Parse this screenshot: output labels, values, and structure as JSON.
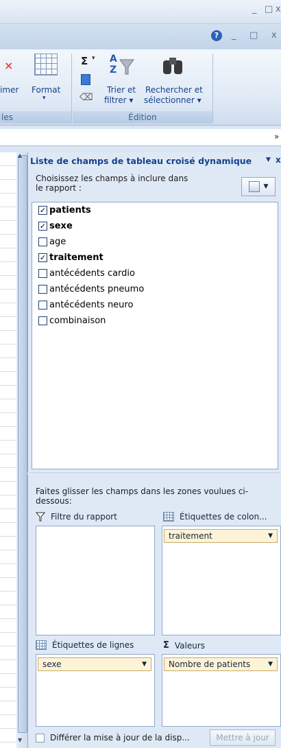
{
  "window": {
    "min": "_",
    "restore": "□",
    "close": "x",
    "help": "?"
  },
  "ribbon": {
    "delete_label": "imer",
    "format_label": "Format",
    "format_arrow": "▾",
    "cells_group": "les",
    "sum_symbol": "Σ",
    "sort_line1": "Trier et",
    "sort_line2": "filtrer ▾",
    "find_line1": "Rechercher et",
    "find_line2": "sélectionner ▾",
    "edit_group": "Édition"
  },
  "pane": {
    "title": "Liste de champs de tableau croisé dynamique",
    "title_arrow": "▼",
    "close": "x",
    "choose_label": "Choisissez les champs à inclure dans le rapport :",
    "fields": [
      {
        "label": "patients",
        "checked": true
      },
      {
        "label": "sexe",
        "checked": true
      },
      {
        "label": "age",
        "checked": false
      },
      {
        "label": "traitement",
        "checked": true
      },
      {
        "label": "antécédents cardio",
        "checked": false
      },
      {
        "label": "antécédents pneumo",
        "checked": false
      },
      {
        "label": "antécédents neuro",
        "checked": false
      },
      {
        "label": "combinaison",
        "checked": false
      }
    ],
    "drag_label": "Faites glisser les champs dans les zones voulues ci-dessous:",
    "zones": {
      "filter": {
        "title": "Filtre du rapport"
      },
      "columns": {
        "title": "Étiquettes de colon...",
        "chip": "traitement"
      },
      "rows": {
        "title": "Étiquettes de lignes",
        "chip": "sexe"
      },
      "values": {
        "title": "Valeurs",
        "chip": "Nombre de patients",
        "symbol": "Σ"
      }
    },
    "defer_label": "Différer la mise à jour de la disp...",
    "update_button": "Mettre à jour"
  }
}
